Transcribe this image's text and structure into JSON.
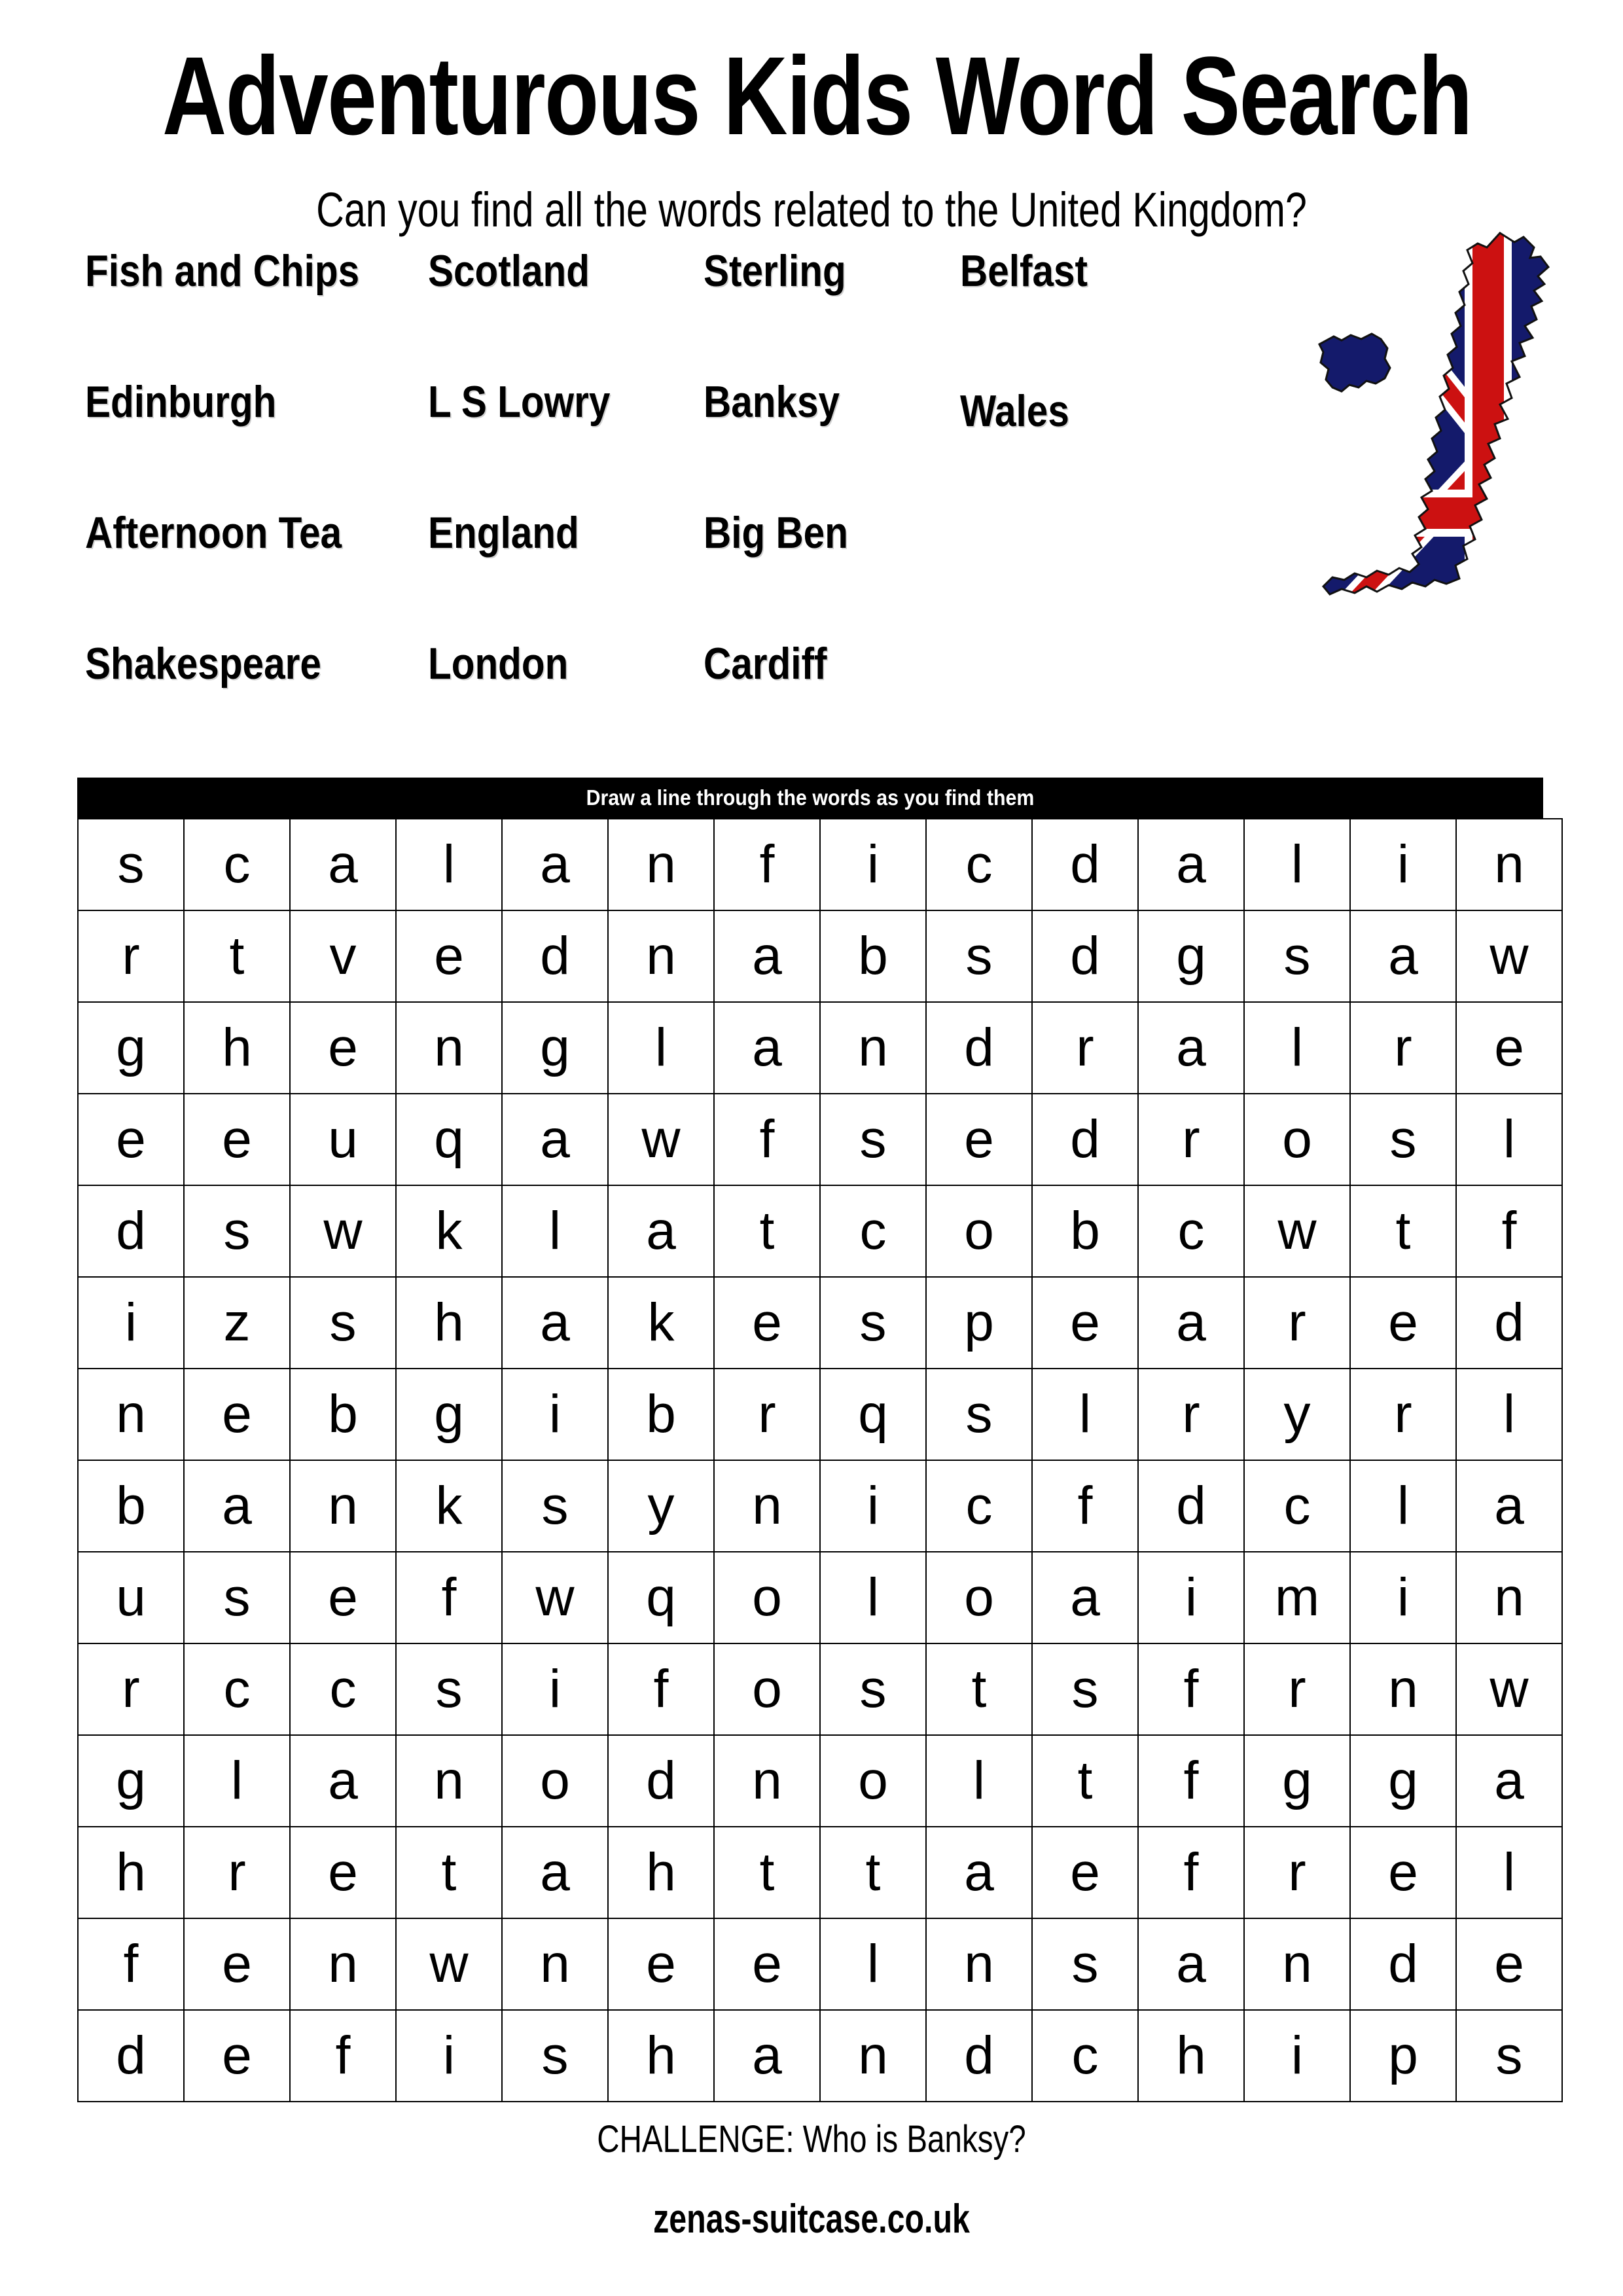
{
  "header": {
    "title": "Adventurous Kids Word Search",
    "subtitle": "Can you find all the words related to the United Kingdom?"
  },
  "word_list": {
    "columns": [
      [
        "Fish and Chips",
        "Edinburgh",
        "Afternoon Tea",
        "Shakespeare"
      ],
      [
        "Scotland",
        "L S Lowry",
        "England",
        "London"
      ],
      [
        "Sterling",
        "Banksy",
        "Big Ben",
        "Cardiff"
      ],
      [
        "Belfast",
        "Wales",
        "",
        ""
      ]
    ],
    "all_words": [
      "Fish and Chips",
      "Scotland",
      "Sterling",
      "Belfast",
      "Edinburgh",
      "L S Lowry",
      "Banksy",
      "Wales",
      "Afternoon Tea",
      "England",
      "Big Ben",
      "Shakespeare",
      "London",
      "Cardiff"
    ]
  },
  "uk_map": {
    "icon": "united-kingdom-flag-map",
    "colors": {
      "navy": "#141A6B",
      "red": "#CC1111",
      "white": "#FFFFFF",
      "outline": "#111111"
    }
  },
  "puzzle": {
    "banner_text": "Draw a line through the words as you find them",
    "banner_bg": "#000000",
    "banner_color": "#FFFFFF",
    "rows": 14,
    "cols": 14,
    "grid": [
      [
        "s",
        "c",
        "a",
        "l",
        "a",
        "n",
        "f",
        "i",
        "c",
        "d",
        "a",
        "l",
        "i",
        "n"
      ],
      [
        "r",
        "t",
        "v",
        "e",
        "d",
        "n",
        "a",
        "b",
        "s",
        "d",
        "g",
        "s",
        "a",
        "w"
      ],
      [
        "g",
        "h",
        "e",
        "n",
        "g",
        "l",
        "a",
        "n",
        "d",
        "r",
        "a",
        "l",
        "r",
        "e"
      ],
      [
        "e",
        "e",
        "u",
        "q",
        "a",
        "w",
        "f",
        "s",
        "e",
        "d",
        "r",
        "o",
        "s",
        "l"
      ],
      [
        "d",
        "s",
        "w",
        "k",
        "l",
        "a",
        "t",
        "c",
        "o",
        "b",
        "c",
        "w",
        "t",
        "f"
      ],
      [
        "i",
        "z",
        "s",
        "h",
        "a",
        "k",
        "e",
        "s",
        "p",
        "e",
        "a",
        "r",
        "e",
        "d"
      ],
      [
        "n",
        "e",
        "b",
        "g",
        "i",
        "b",
        "r",
        "q",
        "s",
        "l",
        "r",
        "y",
        "r",
        "l"
      ],
      [
        "b",
        "a",
        "n",
        "k",
        "s",
        "y",
        "n",
        "i",
        "c",
        "f",
        "d",
        "c",
        "l",
        "a"
      ],
      [
        "u",
        "s",
        "e",
        "f",
        "w",
        "q",
        "o",
        "l",
        "o",
        "a",
        "i",
        "m",
        "i",
        "n"
      ],
      [
        "r",
        "c",
        "c",
        "s",
        "i",
        "f",
        "o",
        "s",
        "t",
        "s",
        "f",
        "r",
        "n",
        "w"
      ],
      [
        "g",
        "l",
        "a",
        "n",
        "o",
        "d",
        "n",
        "o",
        "l",
        "t",
        "f",
        "g",
        "g",
        "a"
      ],
      [
        "h",
        "r",
        "e",
        "t",
        "a",
        "h",
        "t",
        "t",
        "a",
        "e",
        "f",
        "r",
        "e",
        "l"
      ],
      [
        "f",
        "e",
        "n",
        "w",
        "n",
        "e",
        "e",
        "l",
        "n",
        "s",
        "a",
        "n",
        "d",
        "e"
      ],
      [
        "d",
        "e",
        "f",
        "i",
        "s",
        "h",
        "a",
        "n",
        "d",
        "c",
        "h",
        "i",
        "p",
        "s"
      ]
    ]
  },
  "footer": {
    "challenge": "CHALLENGE: Who is Banksy?",
    "site": "zenas-suitcase.co.uk"
  }
}
